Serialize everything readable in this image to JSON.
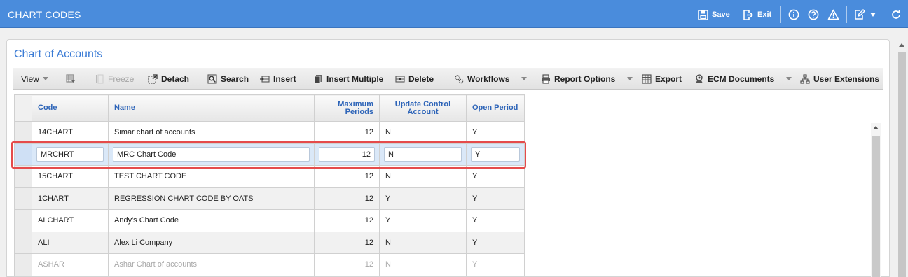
{
  "app": {
    "title": "CHART CODES"
  },
  "titlebar": {
    "save_label": "Save",
    "exit_label": "Exit",
    "icons": [
      "save-icon",
      "exit-icon",
      "info-icon",
      "help-icon",
      "warning-icon",
      "edit-icon",
      "chevron-down-icon",
      "refresh-icon"
    ],
    "bg_color": "#4a8cdc"
  },
  "panel": {
    "title": "Chart of Accounts",
    "title_color": "#3a7bd5"
  },
  "toolbar": {
    "view_label": "View",
    "freeze_label": "Freeze",
    "detach_label": "Detach",
    "search_label": "Search",
    "insert_label": "Insert",
    "insert_multiple_label": "Insert Multiple",
    "delete_label": "Delete",
    "workflows_label": "Workflows",
    "report_options_label": "Report Options",
    "export_label": "Export",
    "ecm_documents_label": "ECM Documents",
    "user_extensions_label": "User Extensions"
  },
  "grid": {
    "headers": {
      "code": "Code",
      "name": "Name",
      "max_periods_1": "Maximum",
      "max_periods_2": "Periods",
      "update_control_1": "Update Control",
      "update_control_2": "Account",
      "open_period": "Open Period"
    },
    "rows": [
      {
        "code": "14CHART",
        "name": "Simar chart of accounts",
        "max_periods": "12",
        "update_control": "N",
        "open_period": "Y"
      },
      {
        "code": "MRCHRT",
        "name": "MRC Chart Code",
        "max_periods": "12",
        "update_control": "N",
        "open_period": "Y"
      },
      {
        "code": "15CHART",
        "name": "TEST CHART CODE",
        "max_periods": "12",
        "update_control": "N",
        "open_period": "Y"
      },
      {
        "code": "1CHART",
        "name": "REGRESSION CHART CODE BY OATS",
        "max_periods": "12",
        "update_control": "Y",
        "open_period": "Y"
      },
      {
        "code": "ALCHART",
        "name": "Andy's Chart Code",
        "max_periods": "12",
        "update_control": "Y",
        "open_period": "Y"
      },
      {
        "code": "ALI",
        "name": "Alex Li Company",
        "max_periods": "12",
        "update_control": "N",
        "open_period": "Y"
      },
      {
        "code": "ASHAR",
        "name": "Ashar Chart of accounts",
        "max_periods": "12",
        "update_control": "N",
        "open_period": "Y"
      }
    ],
    "highlight_color": "#e54b4b",
    "edit_row_color": "#dae8f8"
  }
}
